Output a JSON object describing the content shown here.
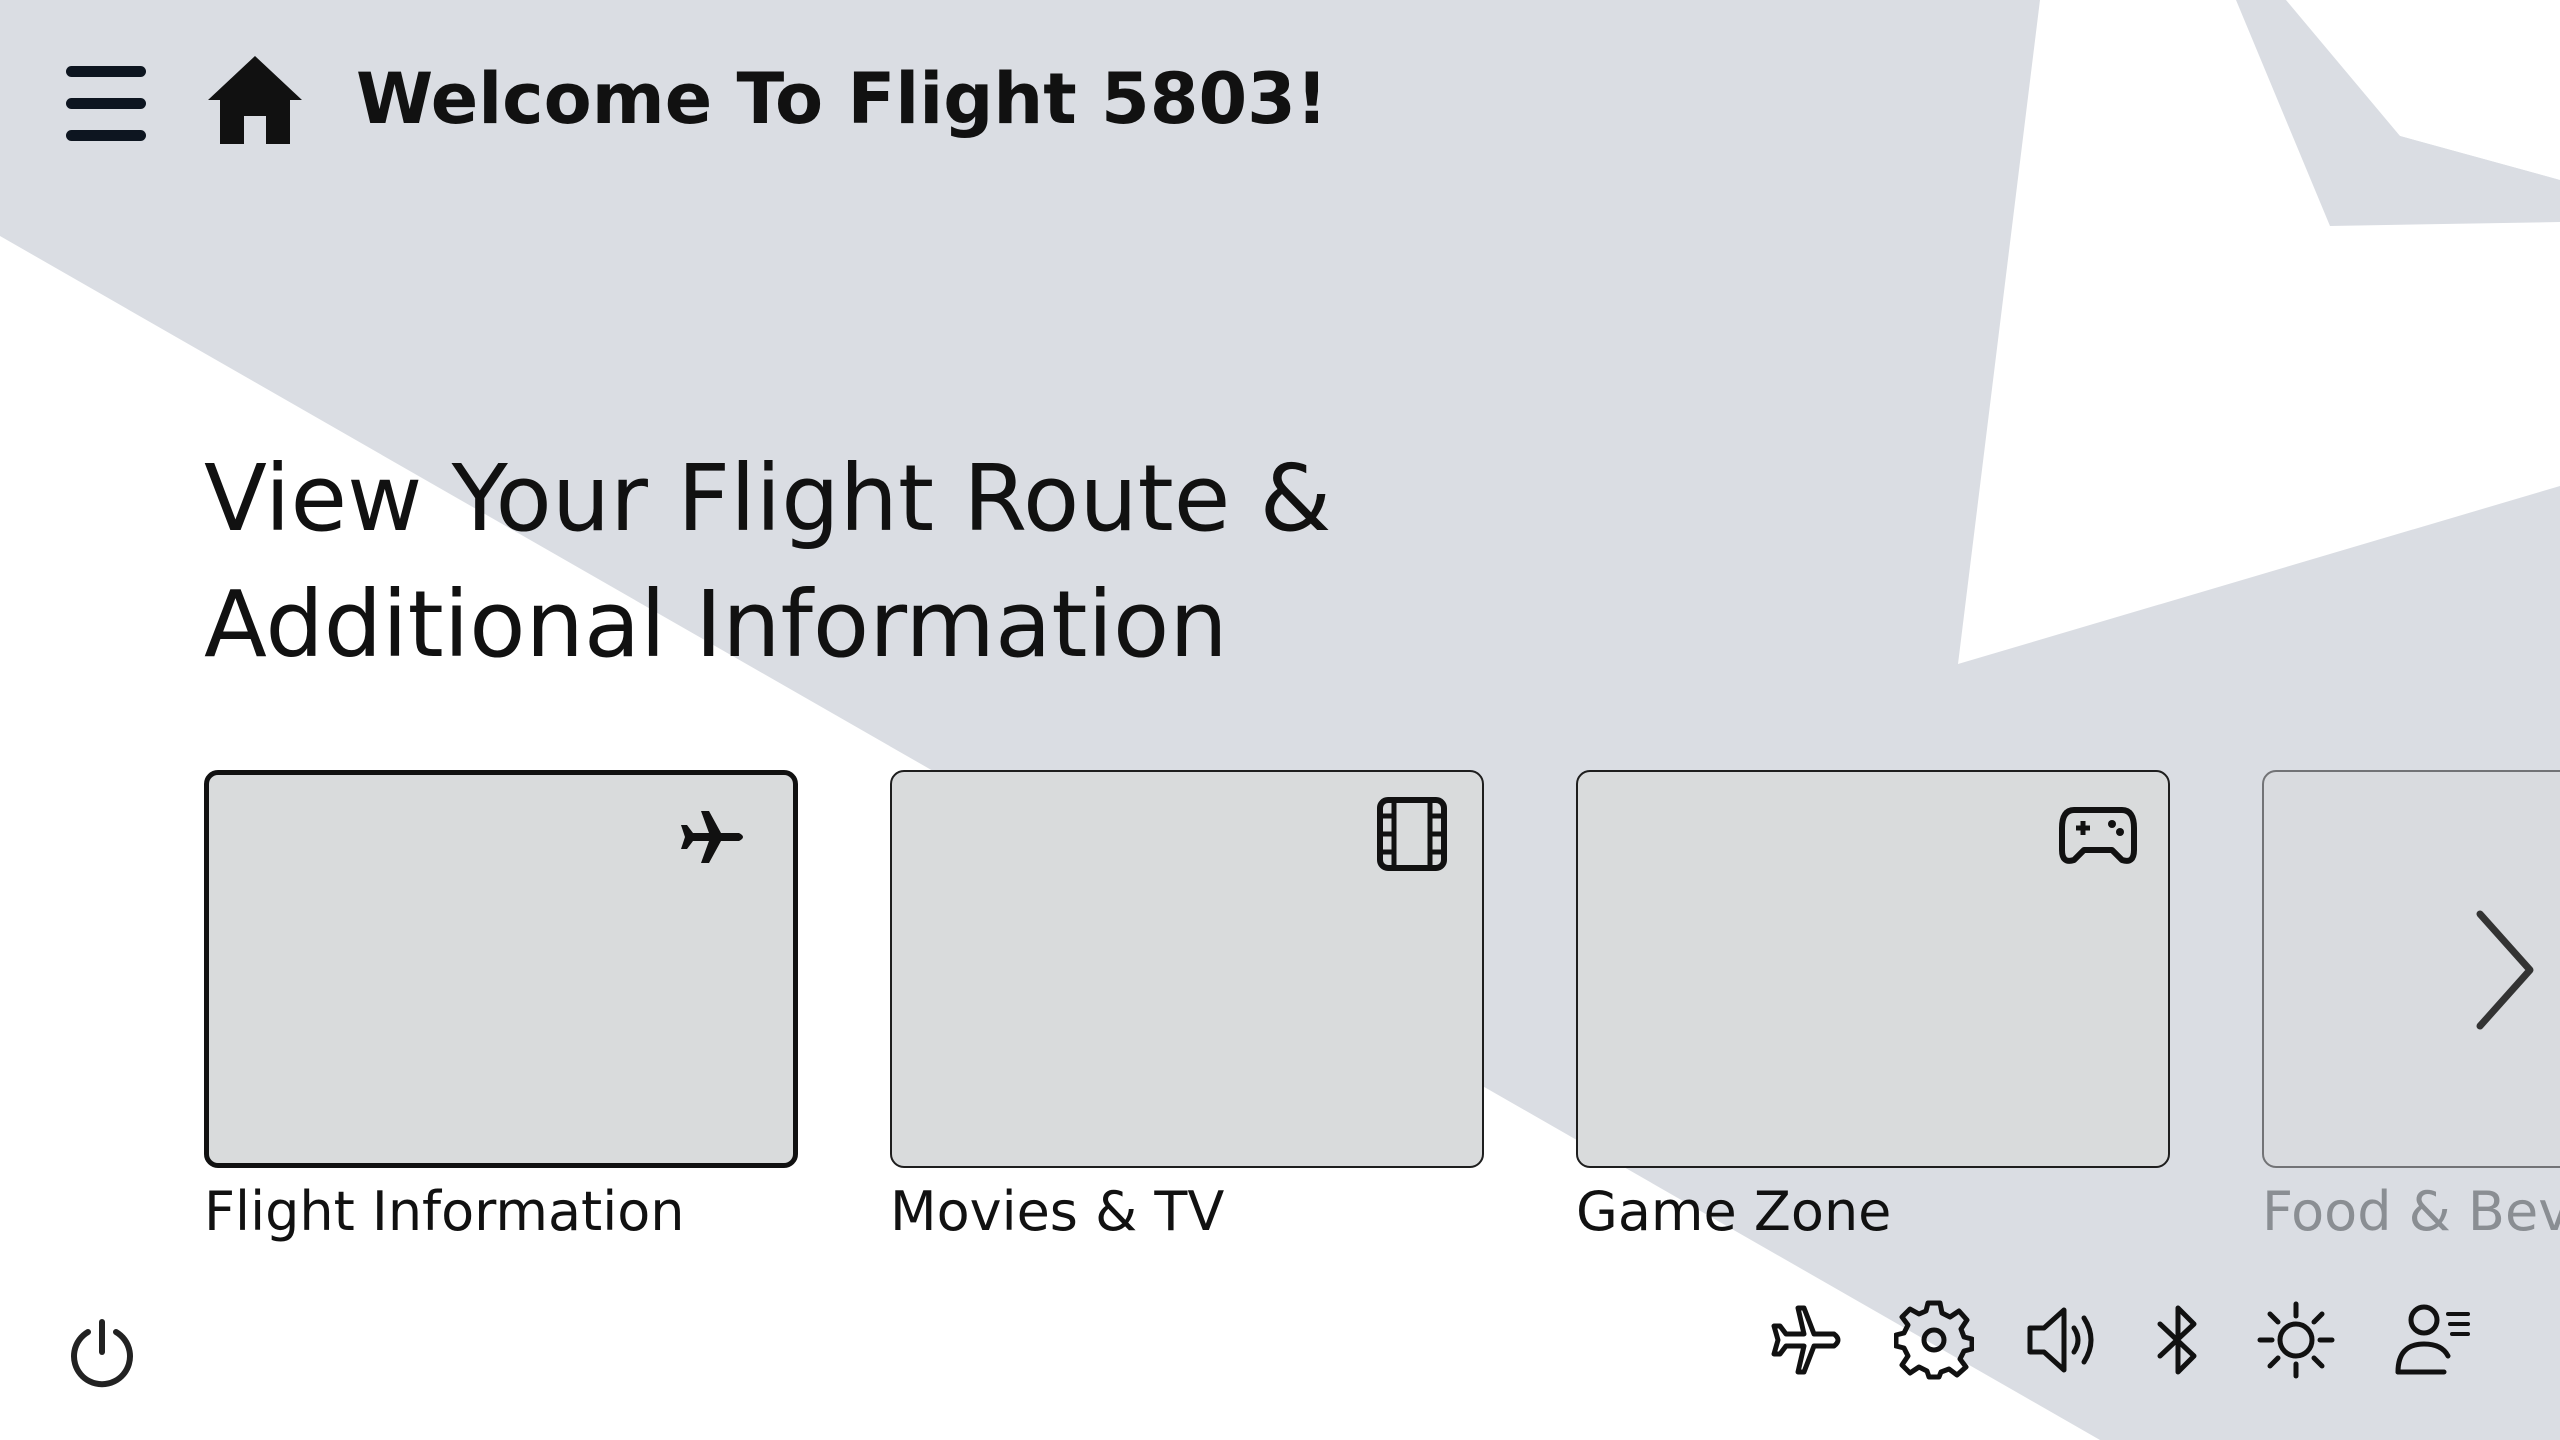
{
  "colors": {
    "background": "#ffffff",
    "backdrop_shape": "#dadde3",
    "card_fill": "#d9dbdc",
    "text": "#111111",
    "muted_text": "#8a8e93"
  },
  "header": {
    "menu_icon": "hamburger-menu-icon",
    "home_icon": "home-icon",
    "title": "Welcome To Flight 5803!"
  },
  "hero": {
    "line1": "View Your Flight Route &",
    "line2": "Additional Information"
  },
  "cards": [
    {
      "label": "Flight Information",
      "icon": "airplane-icon",
      "selected": true
    },
    {
      "label": "Movies & TV",
      "icon": "film-icon",
      "selected": false
    },
    {
      "label": "Game Zone",
      "icon": "gamepad-icon",
      "selected": false
    },
    {
      "label": "Food & Beve",
      "icon": "",
      "selected": false
    }
  ],
  "carousel": {
    "next_icon": "chevron-right-icon"
  },
  "bottom_bar": {
    "power_icon": "power-icon",
    "tray_icons": [
      "airplane-mode-icon",
      "settings-icon",
      "volume-icon",
      "bluetooth-icon",
      "brightness-icon",
      "user-settings-icon"
    ]
  }
}
